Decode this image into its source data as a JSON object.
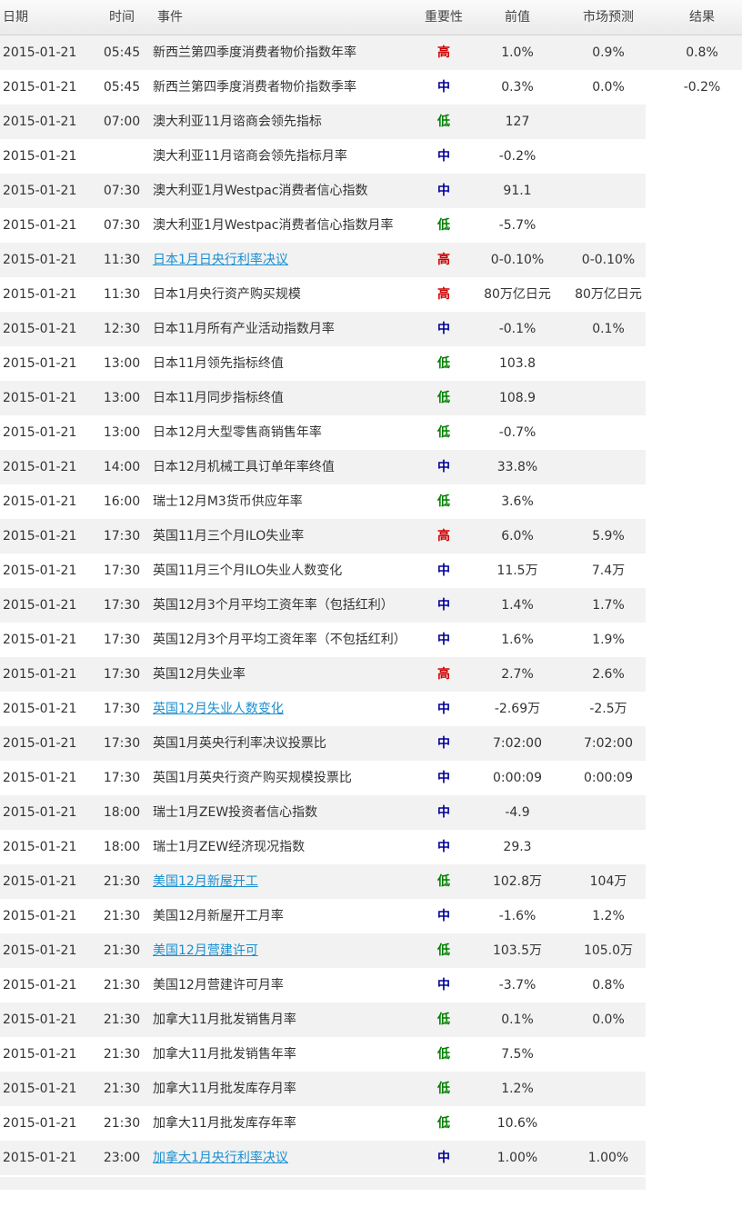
{
  "header": {
    "date": "日期",
    "time": "时间",
    "event": "事件",
    "importance": "重要性",
    "previous": "前值",
    "forecast": "市场预测",
    "result": "结果"
  },
  "importance_colors": {
    "高": "#cc0000",
    "中": "#000099",
    "低": "#008000"
  },
  "rows": [
    {
      "date": "2015-01-21",
      "time": "05:45",
      "event": "新西兰第四季度消费者物价指数年率",
      "importance": "高",
      "previous": "1.0%",
      "forecast": "0.9%",
      "result": "0.8%",
      "link": false
    },
    {
      "date": "2015-01-21",
      "time": "05:45",
      "event": "新西兰第四季度消费者物价指数季率",
      "importance": "中",
      "previous": "0.3%",
      "forecast": "0.0%",
      "result": "-0.2%",
      "link": false
    },
    {
      "date": "2015-01-21",
      "time": "07:00",
      "event": "澳大利亚11月谘商会领先指标",
      "importance": "低",
      "previous": "127",
      "forecast": "",
      "result": "",
      "link": false
    },
    {
      "date": "2015-01-21",
      "time": "",
      "event": "澳大利亚11月谘商会领先指标月率",
      "importance": "中",
      "previous": "-0.2%",
      "forecast": "",
      "result": "",
      "link": false
    },
    {
      "date": "2015-01-21",
      "time": "07:30",
      "event": "澳大利亚1月Westpac消费者信心指数",
      "importance": "中",
      "previous": "91.1",
      "forecast": "",
      "result": "",
      "link": false
    },
    {
      "date": "2015-01-21",
      "time": "07:30",
      "event": "澳大利亚1月Westpac消费者信心指数月率",
      "importance": "低",
      "previous": "-5.7%",
      "forecast": "",
      "result": "",
      "link": false
    },
    {
      "date": "2015-01-21",
      "time": "11:30",
      "event": "日本1月日央行利率决议",
      "importance": "高",
      "previous": "0-0.10%",
      "forecast": "0-0.10%",
      "result": "",
      "link": true
    },
    {
      "date": "2015-01-21",
      "time": "11:30",
      "event": "日本1月央行资产购买规模",
      "importance": "高",
      "previous": "80万亿日元",
      "forecast": "80万亿日元",
      "result": "",
      "link": false
    },
    {
      "date": "2015-01-21",
      "time": "12:30",
      "event": "日本11月所有产业活动指数月率",
      "importance": "中",
      "previous": "-0.1%",
      "forecast": "0.1%",
      "result": "",
      "link": false
    },
    {
      "date": "2015-01-21",
      "time": "13:00",
      "event": "日本11月领先指标终值",
      "importance": "低",
      "previous": "103.8",
      "forecast": "",
      "result": "",
      "link": false
    },
    {
      "date": "2015-01-21",
      "time": "13:00",
      "event": "日本11月同步指标终值",
      "importance": "低",
      "previous": "108.9",
      "forecast": "",
      "result": "",
      "link": false
    },
    {
      "date": "2015-01-21",
      "time": "13:00",
      "event": "日本12月大型零售商销售年率",
      "importance": "低",
      "previous": "-0.7%",
      "forecast": "",
      "result": "",
      "link": false
    },
    {
      "date": "2015-01-21",
      "time": "14:00",
      "event": "日本12月机械工具订单年率终值",
      "importance": "中",
      "previous": "33.8%",
      "forecast": "",
      "result": "",
      "link": false
    },
    {
      "date": "2015-01-21",
      "time": "16:00",
      "event": "瑞士12月M3货币供应年率",
      "importance": "低",
      "previous": "3.6%",
      "forecast": "",
      "result": "",
      "link": false
    },
    {
      "date": "2015-01-21",
      "time": "17:30",
      "event": "英国11月三个月ILO失业率",
      "importance": "高",
      "previous": "6.0%",
      "forecast": "5.9%",
      "result": "",
      "link": false
    },
    {
      "date": "2015-01-21",
      "time": "17:30",
      "event": "英国11月三个月ILO失业人数变化",
      "importance": "中",
      "previous": "11.5万",
      "forecast": "7.4万",
      "result": "",
      "link": false
    },
    {
      "date": "2015-01-21",
      "time": "17:30",
      "event": "英国12月3个月平均工资年率（包括红利）",
      "importance": "中",
      "previous": "1.4%",
      "forecast": "1.7%",
      "result": "",
      "link": false
    },
    {
      "date": "2015-01-21",
      "time": "17:30",
      "event": "英国12月3个月平均工资年率（不包括红利）",
      "importance": "中",
      "previous": "1.6%",
      "forecast": "1.9%",
      "result": "",
      "link": false
    },
    {
      "date": "2015-01-21",
      "time": "17:30",
      "event": "英国12月失业率",
      "importance": "高",
      "previous": "2.7%",
      "forecast": "2.6%",
      "result": "",
      "link": false
    },
    {
      "date": "2015-01-21",
      "time": "17:30",
      "event": "英国12月失业人数变化",
      "importance": "中",
      "previous": "-2.69万",
      "forecast": "-2.5万",
      "result": "",
      "link": true
    },
    {
      "date": "2015-01-21",
      "time": "17:30",
      "event": "英国1月英央行利率决议投票比",
      "importance": "中",
      "previous": "7:02:00",
      "forecast": "7:02:00",
      "result": "",
      "link": false
    },
    {
      "date": "2015-01-21",
      "time": "17:30",
      "event": "英国1月英央行资产购买规模投票比",
      "importance": "中",
      "previous": "0:00:09",
      "forecast": "0:00:09",
      "result": "",
      "link": false
    },
    {
      "date": "2015-01-21",
      "time": "18:00",
      "event": "瑞士1月ZEW投资者信心指数",
      "importance": "中",
      "previous": "-4.9",
      "forecast": "",
      "result": "",
      "link": false
    },
    {
      "date": "2015-01-21",
      "time": "18:00",
      "event": "瑞士1月ZEW经济现况指数",
      "importance": "中",
      "previous": "29.3",
      "forecast": "",
      "result": "",
      "link": false
    },
    {
      "date": "2015-01-21",
      "time": "21:30",
      "event": "美国12月新屋开工",
      "importance": "低",
      "previous": "102.8万",
      "forecast": "104万",
      "result": "",
      "link": true
    },
    {
      "date": "2015-01-21",
      "time": "21:30",
      "event": "美国12月新屋开工月率",
      "importance": "中",
      "previous": "-1.6%",
      "forecast": "1.2%",
      "result": "",
      "link": false
    },
    {
      "date": "2015-01-21",
      "time": "21:30",
      "event": "美国12月营建许可",
      "importance": "低",
      "previous": "103.5万",
      "forecast": "105.0万",
      "result": "",
      "link": true
    },
    {
      "date": "2015-01-21",
      "time": "21:30",
      "event": "美国12月营建许可月率",
      "importance": "中",
      "previous": "-3.7%",
      "forecast": "0.8%",
      "result": "",
      "link": false
    },
    {
      "date": "2015-01-21",
      "time": "21:30",
      "event": "加拿大11月批发销售月率",
      "importance": "低",
      "previous": "0.1%",
      "forecast": "0.0%",
      "result": "",
      "link": false
    },
    {
      "date": "2015-01-21",
      "time": "21:30",
      "event": "加拿大11月批发销售年率",
      "importance": "低",
      "previous": "7.5%",
      "forecast": "",
      "result": "",
      "link": false
    },
    {
      "date": "2015-01-21",
      "time": "21:30",
      "event": "加拿大11月批发库存月率",
      "importance": "低",
      "previous": "1.2%",
      "forecast": "",
      "result": "",
      "link": false
    },
    {
      "date": "2015-01-21",
      "time": "21:30",
      "event": "加拿大11月批发库存年率",
      "importance": "低",
      "previous": "10.6%",
      "forecast": "",
      "result": "",
      "link": false
    },
    {
      "date": "2015-01-21",
      "time": "23:00",
      "event": "加拿大1月央行利率决议",
      "importance": "中",
      "previous": "1.00%",
      "forecast": "1.00%",
      "result": "",
      "link": true
    }
  ]
}
